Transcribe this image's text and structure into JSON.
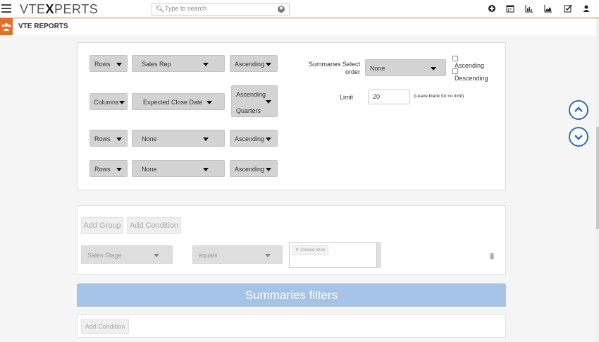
{
  "header": {
    "logo_part1": "VTE",
    "logo_part2": "X",
    "logo_part3": "PERTS",
    "search_placeholder": "Type to search",
    "icons": [
      "add-icon",
      "calendar-icon",
      "bar-chart-icon",
      "area-chart-icon",
      "checkbox-icon",
      "user-icon"
    ]
  },
  "subheader": {
    "title": "VTE REPORTS"
  },
  "grouping": {
    "rows": [
      {
        "type": "Rows",
        "field": "Sales Rep",
        "order": "Ascending"
      },
      {
        "type": "Columns",
        "field": "Expected Close Date",
        "order": "Ascending",
        "order_sub": "Quarters"
      },
      {
        "type": "Rows",
        "field": "None",
        "order": "Ascending"
      },
      {
        "type": "Rows",
        "field": "None",
        "order": "Ascending"
      }
    ],
    "summaries_label": "Summaries Select order",
    "summaries_value": "None",
    "asc_label": "Ascending",
    "desc_label": "Descending",
    "limit_label": "Limit",
    "limit_value": "20",
    "limit_hint": "(Leave blank for no limit)"
  },
  "conditions": {
    "add_group": "Add Group",
    "add_condition": "Add Condition",
    "field": "Sales Stage",
    "operator": "equals",
    "tag": "Closed Won"
  },
  "summaries": {
    "title": "Summaries filters",
    "add_condition": "Add Condition"
  },
  "colors": {
    "accent": "#e46f28",
    "banner": "#a6c3e8",
    "nav_circle": "#2f6fb5"
  }
}
